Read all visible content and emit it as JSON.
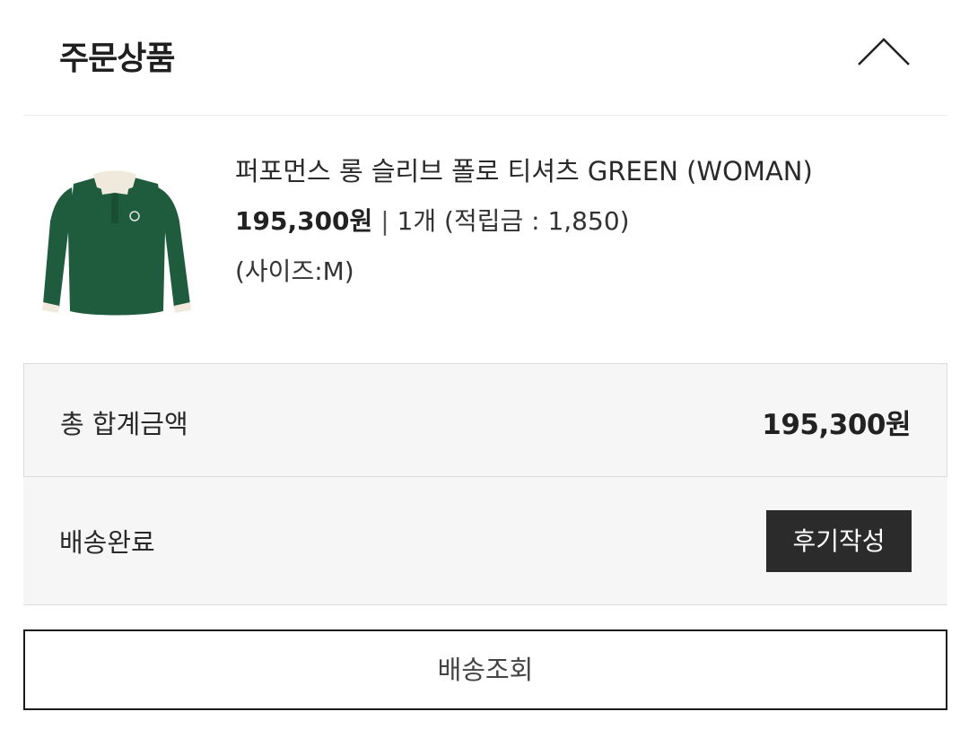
{
  "header": {
    "title": "주문상품",
    "toggle_icon": "chevron-up-icon"
  },
  "product": {
    "name": "퍼포먼스 롱 슬리브 폴로 티셔츠 GREEN (WOMAN)",
    "price": "195,300원",
    "separator": "|",
    "quantity": "1개",
    "points": "(적립금 : 1,850)",
    "option": "(사이즈:M)",
    "image_icon": "green-polo-shirt-image",
    "colors": {
      "shirt": "#1f5c3d",
      "collar": "#efeadc"
    }
  },
  "summary": {
    "total_label": "총 합계금액",
    "total_value": "195,300원"
  },
  "status": {
    "label": "배송완료",
    "review_button": "후기작성"
  },
  "tracking": {
    "button_label": "배송조회"
  },
  "colors": {
    "panel_bg": "#f6f6f6",
    "dark_button": "#2b2b2b",
    "border": "#dcdcdc"
  }
}
